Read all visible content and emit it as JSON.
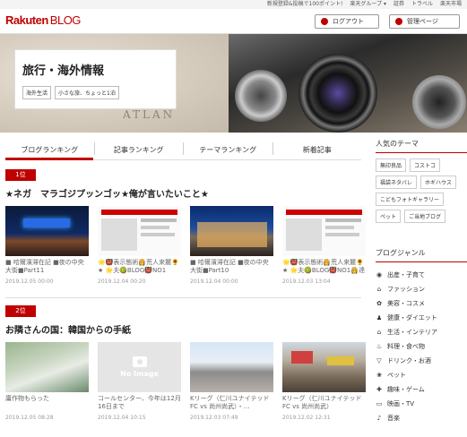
{
  "topbar": {
    "links": [
      "新規登録&投稿で100ポイント!",
      "楽天グループ ▾",
      "証券",
      "トラベル",
      "楽天市場"
    ]
  },
  "header": {
    "logo_text": "Rakuten",
    "logo_sub": "BLOG",
    "logout_label": "ログアウト",
    "manage_label": "管理ページ",
    "accent_color": "#bf0000"
  },
  "hero": {
    "title": "旅行・海外情報",
    "tags": [
      "海外生活",
      "小さな旅、ちょっと1泊"
    ],
    "map_text": "ATLAN"
  },
  "tabs": [
    {
      "label": "ブログランキング",
      "active": true
    },
    {
      "label": "記事ランキング",
      "active": false
    },
    {
      "label": "テーマランキング",
      "active": false
    },
    {
      "label": "新着記事",
      "active": false
    }
  ],
  "rankings": [
    {
      "rank": "1位",
      "title": "★ネガ　マラゴジプッンゴッ★俺が言いたいこと★",
      "cards": [
        {
          "text": "■ 哈爾濱滞在記 ■夜の中央大街■Part11",
          "date": "2019.12.05 00:00"
        },
        {
          "text": "🌟👹表示態術👸荒人来麓🌻★ 🌟夫🥝BLOG👹NO1",
          "date": "2019.12.04 00:20"
        },
        {
          "text": "■ 哈爾濱滞在記 ■夜の中央大街■Part10",
          "date": "2019.12.04 00:00"
        },
        {
          "text": "🌟👹表示態術👸荒人来麓🌻★ 🌟夫🥝BLOG👹NO1👸達成",
          "date": "2019.12.03 13:04"
        }
      ]
    },
    {
      "rank": "2位",
      "title": "お隣さんの国：韓国からの手紙",
      "cards": [
        {
          "text": "庸作物もらった",
          "date": "2019.12.05 08:28"
        },
        {
          "text": "コールセンター、今年は12月16日まで",
          "date": "2019.12.04 10:15",
          "no_image": "No Image"
        },
        {
          "text": "Kリーグ（仁川ユナイテッドFC vs 尚州尚武）・…",
          "date": "2019.12.03 07:49"
        },
        {
          "text": "Kリーグ（仁川ユナイテッドFC vs 尚州尚武）",
          "date": "2019.12.02 12:31"
        }
      ]
    }
  ],
  "sidebar": {
    "popular_title": "人気のテーマ",
    "popular_tags": [
      "無印良品",
      "コストコ",
      "福袋ネタバレ",
      "ホギハウス",
      "こどもフォトギャラリー",
      "ペット",
      "ご当地ブログ"
    ],
    "genre_title": "ブログジャンル",
    "genres": [
      {
        "label": "出産・子育て",
        "icon": "baby-icon"
      },
      {
        "label": "ファッション",
        "icon": "hanger-icon"
      },
      {
        "label": "美容・コスメ",
        "icon": "cosmetics-icon"
      },
      {
        "label": "健康・ダイエット",
        "icon": "running-icon"
      },
      {
        "label": "生活・インテリア",
        "icon": "home-icon"
      },
      {
        "label": "料理・食べ物",
        "icon": "cooking-icon"
      },
      {
        "label": "ドリンク・お酒",
        "icon": "glass-icon"
      },
      {
        "label": "ペット",
        "icon": "paw-icon"
      },
      {
        "label": "趣味・ゲーム",
        "icon": "gamepad-icon"
      },
      {
        "label": "映画・TV",
        "icon": "tv-icon"
      },
      {
        "label": "音楽",
        "icon": "music-icon"
      }
    ]
  }
}
